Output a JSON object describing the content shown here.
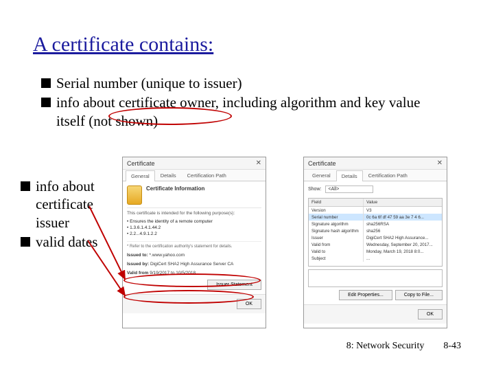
{
  "title": "A certificate contains:",
  "top_bullets": [
    "Serial number (unique to issuer)",
    "info about certificate owner, including algorithm and key value itself (not shown)"
  ],
  "left_bullets": [
    "info about certificate issuer",
    "valid dates"
  ],
  "cert_general": {
    "window_title": "Certificate",
    "tabs": {
      "general": "General",
      "details": "Details",
      "path": "Certification Path"
    },
    "heading": "Certificate Information",
    "purpose_intro": "This certificate is intended for the following purpose(s):",
    "oid1": "• Ensures the identity of a remote computer",
    "oid2": "• 1.3.6.1.4.1.44.2",
    "oid3": "• 2.2...4.9.1.2.2",
    "note": "* Refer to the certification authority's statement for details.",
    "issued_to_label": "Issued to:",
    "issued_to": "*.www.yahoo.com",
    "issued_by_label": "Issued by:",
    "issued_by": "DigiCert SHA2 High Assurance Server CA",
    "valid_label": "Valid from",
    "valid": "9/19/2017 to 10/5/2018",
    "buttons": {
      "statement": "Issuer Statement"
    },
    "ok": "OK"
  },
  "cert_details": {
    "window_title": "Certificate",
    "tabs": {
      "general": "General",
      "details": "Details",
      "path": "Certification Path"
    },
    "show_label": "Show:",
    "show_value": "<All>",
    "columns": {
      "field": "Field",
      "value": "Value"
    },
    "rows": [
      {
        "field": "Version",
        "value": "V3"
      },
      {
        "field": "Serial number",
        "value": "0c 6a 6f df 47 59 aa 3e 7 4 6..."
      },
      {
        "field": "Signature algorithm",
        "value": "sha256RSA"
      },
      {
        "field": "Signature hash algorithm",
        "value": "sha256"
      },
      {
        "field": "Issuer",
        "value": "DigiCert SHA2 High Assurance..."
      },
      {
        "field": "Valid from",
        "value": "Wednesday, September 20, 2017..."
      },
      {
        "field": "Valid to",
        "value": "Monday, March 19, 2018 8:0..."
      },
      {
        "field": "Subject",
        "value": "..."
      }
    ],
    "buttons": {
      "edit": "Edit Properties...",
      "copy": "Copy to File..."
    },
    "ok": "OK"
  },
  "footer": {
    "section": "8: Network Security",
    "page": "8-43"
  }
}
